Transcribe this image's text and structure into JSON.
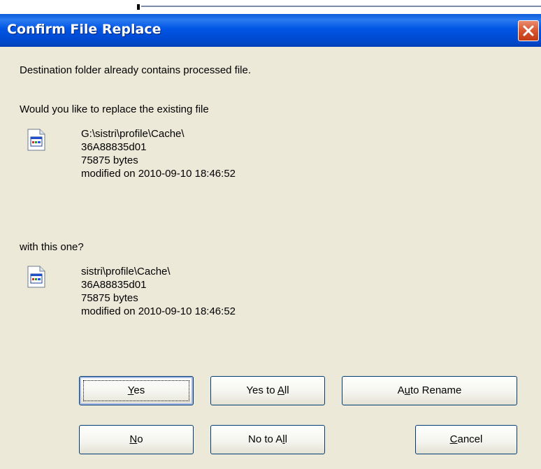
{
  "window": {
    "title": "Confirm File Replace"
  },
  "message": {
    "line1": "Destination folder already contains processed file.",
    "question_existing": "Would you like to replace the existing file",
    "question_new": "with this one?"
  },
  "existing_file": {
    "path": "G:\\sistri\\profile\\Cache\\",
    "name": "36A88835d01",
    "size": "75875 bytes",
    "modified": "modified on 2010-09-10 18:46:52",
    "icon": "document-icon"
  },
  "new_file": {
    "path": "sistri\\profile\\Cache\\",
    "name": "36A88835d01",
    "size": "75875 bytes",
    "modified": "modified on 2010-09-10 18:46:52",
    "icon": "document-icon"
  },
  "buttons": {
    "yes": {
      "pre": "",
      "key": "Y",
      "post": "es"
    },
    "yes_to_all": {
      "pre": "Yes to ",
      "key": "A",
      "post": "ll"
    },
    "auto_rename": {
      "pre": "A",
      "key": "u",
      "post": "to Rename"
    },
    "no": {
      "pre": "",
      "key": "N",
      "post": "o"
    },
    "no_to_all": {
      "pre": "No to A",
      "key": "l",
      "post": "l"
    },
    "cancel": {
      "pre": "",
      "key": "C",
      "post": "ancel"
    }
  },
  "colors": {
    "titlebar": "#0055e5",
    "dialog_bg": "#ece9d8",
    "close_button": "#d8552f"
  }
}
